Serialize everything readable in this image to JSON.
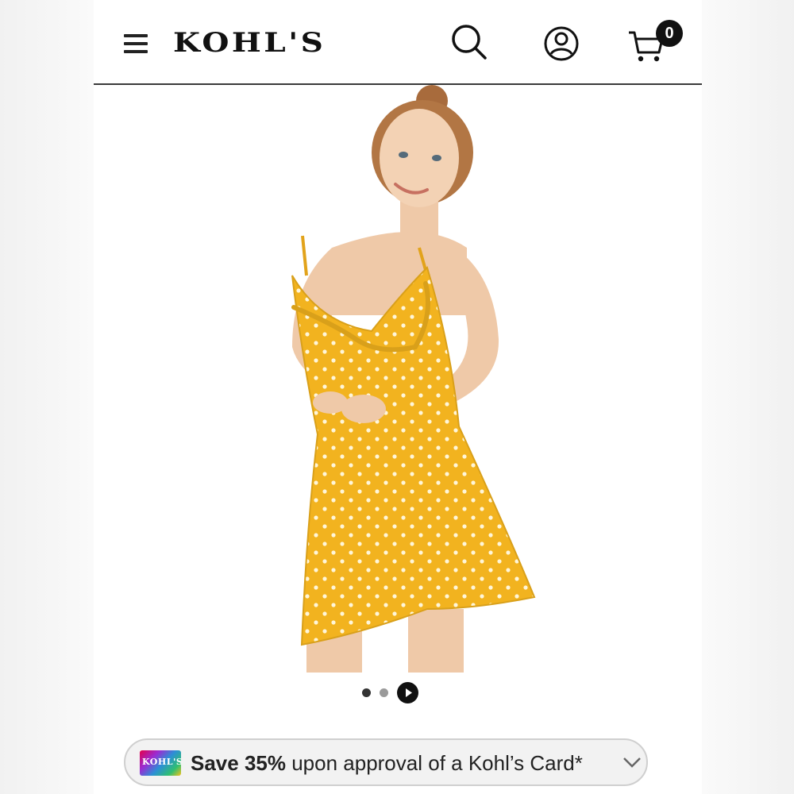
{
  "brand": {
    "logo_text": "KOHL'S"
  },
  "header": {
    "icons": [
      "menu-icon",
      "search-icon",
      "account-icon",
      "cart-icon"
    ],
    "cart_count": "0"
  },
  "product_gallery": {
    "image_description": "Model wearing yellow polka dot ruffle wrap dress",
    "dress_color": "#f2b31f",
    "slide_count": 3,
    "active_slide": 1
  },
  "promo": {
    "bold_text": "Save 35%",
    "text": " upon approval of a Kohl’s Card*",
    "card_logo_text": "KOHL'S"
  },
  "colors": {
    "text": "#111111",
    "promo_bg": "#f2f2f2",
    "header_rule": "#3a3a3a"
  }
}
